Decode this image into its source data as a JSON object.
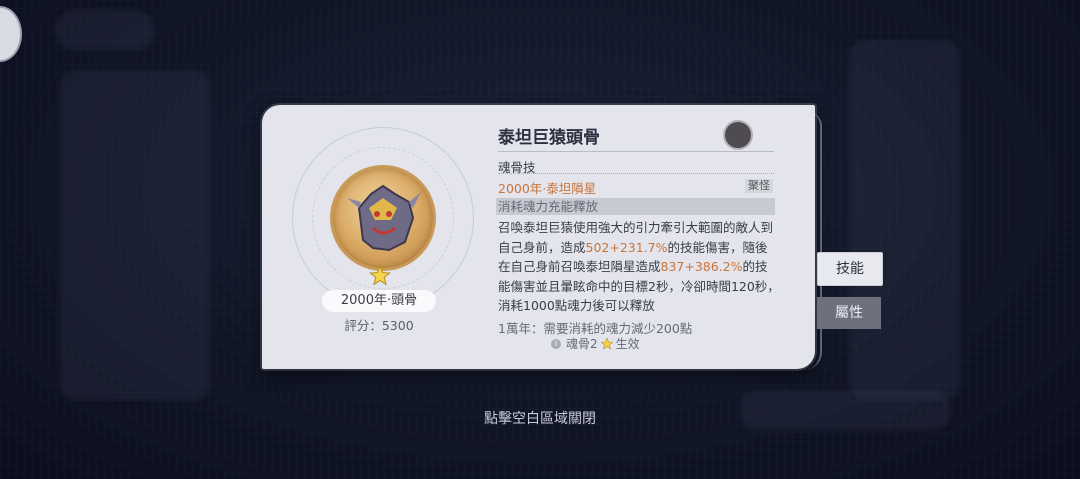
{
  "item": {
    "name_pill": "2000年·頭骨",
    "score": "評分：5300",
    "title": "泰坦巨猿頭骨"
  },
  "skill": {
    "section": "魂骨技",
    "name": "2000年·泰坦隕星",
    "tag": "聚怪",
    "cost": "消耗魂力充能釋放",
    "desc_1": "召喚泰坦巨猿使用強大的引力牽引大範圍的敵人到自己身前，造成",
    "desc_2": "502",
    "desc_3": "+231.7%",
    "desc_4": "的技能傷害，隨後在自己身前召喚泰坦隕星造成",
    "desc_5": "837",
    "desc_6": "+386.2%",
    "desc_7": "的技能傷害並且暈眩命中的目標2秒，冷卻時間120秒，消耗1000點魂力後可以釋放",
    "extra": "1萬年：需要消耗的魂力減少200點",
    "cond_prefix": "魂骨2",
    "cond_suffix": "生效"
  },
  "tabs": {
    "skill": "技能",
    "attribute": "屬性"
  },
  "hint": "點擊空白區域關閉",
  "colors": {
    "accent": "#c8753a",
    "card": "#e4e5ec",
    "star": "#f5d34a"
  }
}
